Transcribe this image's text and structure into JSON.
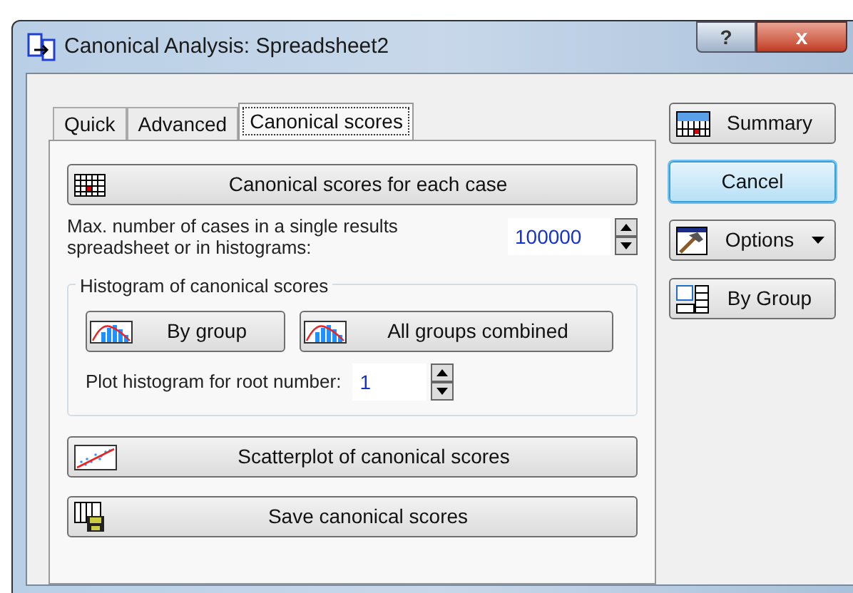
{
  "window": {
    "title": "Canonical Analysis: Spreadsheet2",
    "help_button": "?",
    "close_button": "x"
  },
  "tabs": [
    {
      "label": "Quick",
      "selected": false
    },
    {
      "label": "Advanced",
      "selected": false
    },
    {
      "label": "Canonical scores",
      "selected": true
    }
  ],
  "scores_button": {
    "label": "Canonical scores for each case",
    "kind": "grid"
  },
  "max_cases": {
    "label": "Max. number of cases in a single results spreadsheet or in histograms:",
    "value": "100000"
  },
  "histogram_group": {
    "title": "Histogram of canonical scores",
    "buttons": [
      {
        "label": "By group",
        "kind": "histogram"
      },
      {
        "label": "All groups combined",
        "kind": "histogram"
      }
    ],
    "root_number": {
      "label": "Plot histogram for root number:",
      "value": "1"
    }
  },
  "bottom_buttons": [
    {
      "label": "Scatterplot of canonical scores",
      "kind": "scatter"
    },
    {
      "label": "Save canonical scores",
      "kind": "save"
    }
  ],
  "side_buttons": [
    {
      "label": "Summary",
      "kind": "summary",
      "focused": false,
      "dropdown": false
    },
    {
      "label": "Cancel",
      "kind": "plain",
      "focused": true,
      "dropdown": false
    },
    {
      "label": "Options",
      "kind": "options",
      "focused": false,
      "dropdown": true
    },
    {
      "label": "By Group",
      "kind": "bygroup",
      "focused": false,
      "dropdown": false
    }
  ]
}
